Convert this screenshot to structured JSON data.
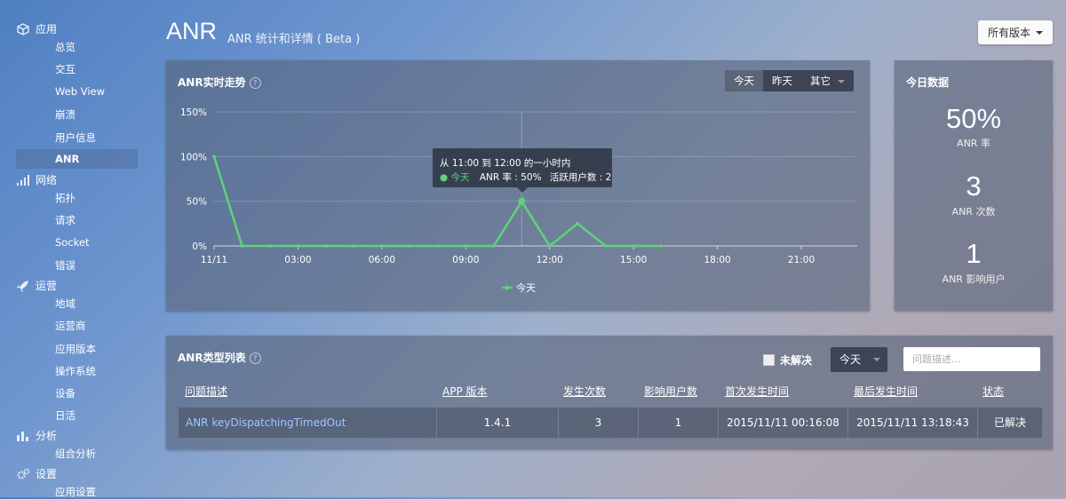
{
  "sidebar": {
    "sections": [
      {
        "label": "应用",
        "icon": "cube-icon",
        "items": [
          "总览",
          "交互",
          "Web View",
          "崩溃",
          "用户信息",
          "ANR"
        ]
      },
      {
        "label": "网络",
        "icon": "signal-icon",
        "items": [
          "拓扑",
          "请求",
          "Socket",
          "错误"
        ]
      },
      {
        "label": "运营",
        "icon": "rocket-icon",
        "items": [
          "地域",
          "运营商",
          "应用版本",
          "操作系统",
          "设备",
          "日活"
        ]
      },
      {
        "label": "分析",
        "icon": "bar-chart-icon",
        "items": [
          "组合分析"
        ]
      },
      {
        "label": "设置",
        "icon": "gear-icon",
        "items": [
          "应用设置"
        ]
      }
    ],
    "active_item": "ANR"
  },
  "header": {
    "title": "ANR",
    "subtitle": "ANR 统计和详情 ( Beta )",
    "version_button": "所有版本"
  },
  "trend": {
    "title": "ANR实时走势",
    "help": "?",
    "tabs": [
      "今天",
      "昨天",
      "其它"
    ],
    "active_tab": "今天",
    "tooltip": {
      "line1": "从 11:00 到 12:00 的一小时内",
      "series": "● 今天",
      "rate": "ANR 率 : 50%",
      "users": "活跃用户数 : 2"
    }
  },
  "chart_data": {
    "type": "line",
    "x": [
      "11/11 00:00",
      "01:00",
      "02:00",
      "03:00",
      "04:00",
      "05:00",
      "06:00",
      "07:00",
      "08:00",
      "09:00",
      "10:00",
      "11:00",
      "12:00",
      "13:00",
      "14:00",
      "15:00",
      "16:00"
    ],
    "x_tick_labels": [
      "11/11",
      "03:00",
      "06:00",
      "09:00",
      "12:00",
      "15:00",
      "18:00",
      "21:00"
    ],
    "series": [
      {
        "name": "今天",
        "values": [
          100,
          0,
          0,
          0,
          0,
          0,
          0,
          0,
          0,
          0,
          0,
          50,
          0,
          25,
          0,
          0,
          0
        ],
        "color": "#5fd27a"
      }
    ],
    "y_tick_labels": [
      "0%",
      "50%",
      "100%",
      "150%"
    ],
    "ylim": [
      0,
      150
    ],
    "grid": true,
    "legend": "bottom-center"
  },
  "today": {
    "title": "今日数据",
    "stats": [
      {
        "value": "50%",
        "label": "ANR 率"
      },
      {
        "value": "3",
        "label": "ANR 次数"
      },
      {
        "value": "1",
        "label": "ANR 影响用户"
      }
    ]
  },
  "types": {
    "title": "ANR类型列表",
    "help": "?",
    "unresolved_label": "未解决",
    "period": "今天",
    "search_placeholder": "问题描述...",
    "columns": [
      "问题描述",
      "APP 版本",
      "发生次数",
      "影响用户数",
      "首次发生时间",
      "最后发生时间",
      "状态"
    ],
    "rows": [
      [
        "ANR keyDispatchingTimedOut",
        "1.4.1",
        "3",
        "1",
        "2015/11/11 00:16:08",
        "2015/11/11 13:18:43",
        "已解决"
      ]
    ]
  }
}
